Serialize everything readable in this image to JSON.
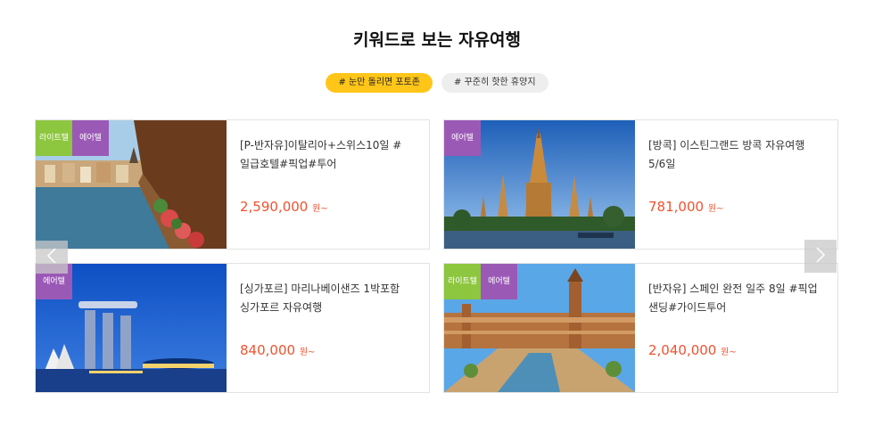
{
  "section_title": "키워드로 보는 자유여행",
  "tabs": [
    {
      "label": "# 눈만 돌리면 포토존"
    },
    {
      "label": "# 꾸준히 핫한 휴양지"
    }
  ],
  "products": [
    {
      "badges": [
        "라이트텔",
        "에어텔"
      ],
      "title": "[P-반자유]이탈리아+스위스10일 #일급호텔#픽업#투어",
      "price": "2,590,000",
      "unit": "원~",
      "image": "lucerne-chapel-bridge"
    },
    {
      "badges": [
        "에어텔"
      ],
      "title": "[방콕] 이스틴그랜드 방콕 자유여행 5/6일",
      "price": "781,000",
      "unit": "원~",
      "image": "wat-arun-temple"
    },
    {
      "badges": [
        "에어텔"
      ],
      "title": "[싱가포르] 마리나베이샌즈 1박포함 싱가포르 자유여행",
      "price": "840,000",
      "unit": "원~",
      "image": "marina-bay-sands"
    },
    {
      "badges": [
        "라이트텔",
        "에어텔"
      ],
      "title": "[반자유] 스페인 완전 일주 8일 #픽업샌딩#가이드투어",
      "price": "2,040,000",
      "unit": "원~",
      "image": "plaza-de-espana"
    }
  ],
  "arrows": {
    "prev_icon": "chevron-left-icon",
    "next_icon": "chevron-right-icon"
  },
  "colors": {
    "active_tab": "#ffc619",
    "price": "#f0522f",
    "badge_green": "#8dc63f",
    "badge_purple": "#9b59b6"
  }
}
